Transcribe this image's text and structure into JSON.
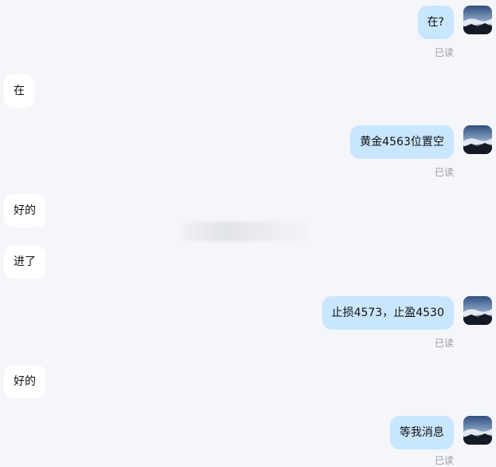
{
  "messages": [
    {
      "direction": "out",
      "text": "在?",
      "status": "已读"
    },
    {
      "direction": "in",
      "text": "在"
    },
    {
      "direction": "out",
      "text": "黄金4563位置空",
      "status": "已读"
    },
    {
      "direction": "in",
      "text": "好的"
    },
    {
      "direction": "in",
      "text": "进了"
    },
    {
      "direction": "out",
      "text": "止损4573，止盈4530",
      "status": "已读"
    },
    {
      "direction": "in",
      "text": "好的"
    },
    {
      "direction": "out",
      "text": "等我消息",
      "status": "已读"
    }
  ],
  "icons": {
    "avatar": "landscape-avatar-icon"
  },
  "colors": {
    "background": "#f5f6fa",
    "outgoing_bubble": "#c9e6ff",
    "incoming_bubble": "#ffffff",
    "read_status": "#9a9a9a"
  }
}
